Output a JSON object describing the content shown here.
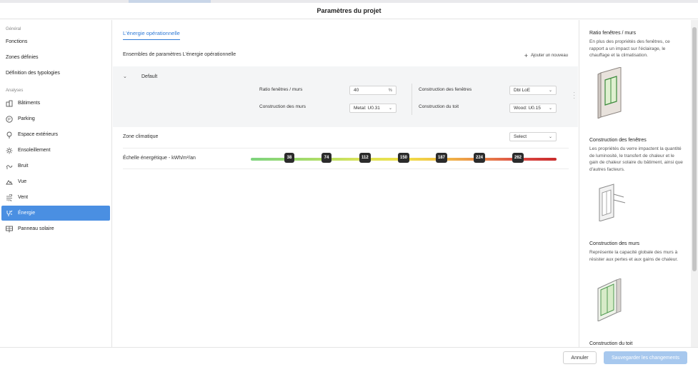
{
  "header": {
    "title": "Paramètres du projet"
  },
  "sidebar": {
    "section_general": "Général",
    "general_items": [
      {
        "label": "Fonctions"
      },
      {
        "label": "Zones définies"
      },
      {
        "label": "Définition des typologies"
      }
    ],
    "section_analyses": "Analyses",
    "analysis_items": [
      {
        "label": "Bâtiments",
        "icon": "buildings-icon"
      },
      {
        "label": "Parking",
        "icon": "parking-icon"
      },
      {
        "label": "Espace extérieurs",
        "icon": "tree-icon"
      },
      {
        "label": "Ensoleillement",
        "icon": "sun-icon"
      },
      {
        "label": "Bruit",
        "icon": "noise-icon"
      },
      {
        "label": "Vue",
        "icon": "eye-icon"
      },
      {
        "label": "Vent",
        "icon": "wind-icon"
      },
      {
        "label": "Énergie",
        "icon": "energy-icon",
        "active": true
      },
      {
        "label": "Panneau solaire",
        "icon": "solar-panel-icon"
      }
    ]
  },
  "main": {
    "tab_label": "L'énergie opérationnelle",
    "sets_title": "Ensembles de paramètres L'énergie opérationnelle",
    "add_new_label": "Ajouter un nouveau",
    "default_set": {
      "name": "Default",
      "ratio_label": "Ratio fenêtres / murs",
      "ratio_value": "40",
      "ratio_unit": "%",
      "walls_label": "Construction des murs",
      "walls_value": "Metal: U0.31",
      "windows_label": "Construction des fenêtres",
      "windows_value": "Dbl LoE",
      "roof_label": "Construction du toit",
      "roof_value": "Wood: U0.15"
    },
    "climate_zone_label": "Zone climatique",
    "climate_zone_value": "Select",
    "energy_scale_label": "Échelle énergétique - kWh/m²/an",
    "energy_scale_ticks": [
      "38",
      "74",
      "112",
      "150",
      "187",
      "224",
      "262"
    ]
  },
  "help": [
    {
      "title": "Ratio fenêtres / murs",
      "desc": "En plus des propriétés des fenêtres, ce rapport a un impact sur l'éclairage, le chauffage et la climatisation."
    },
    {
      "title": "Construction des fenêtres",
      "desc": "Les propriétés du verre impactent la quantité de luminosité, le transfert de chaleur et le gain de chaleur solaire du bâtiment, ainsi que d'autres facteurs."
    },
    {
      "title": "Construction des murs",
      "desc": "Représente la capacité globale des murs à résister aux pertes et aux gains de chaleur."
    },
    {
      "title": "Construction du toit",
      "desc": ""
    }
  ],
  "footer": {
    "cancel_label": "Annuler",
    "save_label": "Sauvegarder les changements"
  },
  "colors": {
    "accent": "#4a8fe2",
    "save_disabled": "#a7c8ee",
    "tab_blue": "#2f7ad6"
  }
}
